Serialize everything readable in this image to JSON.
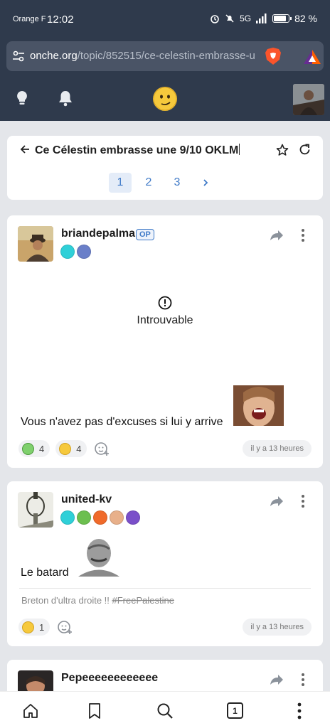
{
  "status_bar": {
    "carrier": "Orange F",
    "time": "12:02",
    "network": "5G",
    "battery": "82 %"
  },
  "browser": {
    "url_domain": "onche.org",
    "url_path": "/topic/852515/ce-celestin-embrasse-u"
  },
  "topic": {
    "title": "Ce Célestin embrasse une 9/10 OKLM",
    "pages": [
      "1",
      "2",
      "3"
    ],
    "current_page": "1"
  },
  "posts": [
    {
      "username": "briandepalma",
      "op_label": "OP",
      "missing_text": "Introuvable",
      "text": "Vous n'avez pas d'excuses si lui y arrive",
      "reactions": [
        {
          "icon": "sick-emoji-icon",
          "count": "4"
        },
        {
          "icon": "smirk-emoji-icon",
          "count": "4"
        }
      ],
      "time": "il y a 13 heures"
    },
    {
      "username": "united-kv",
      "text": "Le batard",
      "signature_text": "Breton d'ultra droite !! ",
      "signature_tag": "#FreePalestine",
      "reactions": [
        {
          "icon": "worried-emoji-icon",
          "count": "1"
        }
      ],
      "time": "il y a 13 heures"
    },
    {
      "username": "Pepeeeeeeeeeeee"
    }
  ],
  "bottom_nav": {
    "tab_count": "1"
  },
  "colors": {
    "header_bg": "#2f3a4c",
    "accent": "#3f7ac8",
    "page_bg": "#e4e6ea"
  }
}
